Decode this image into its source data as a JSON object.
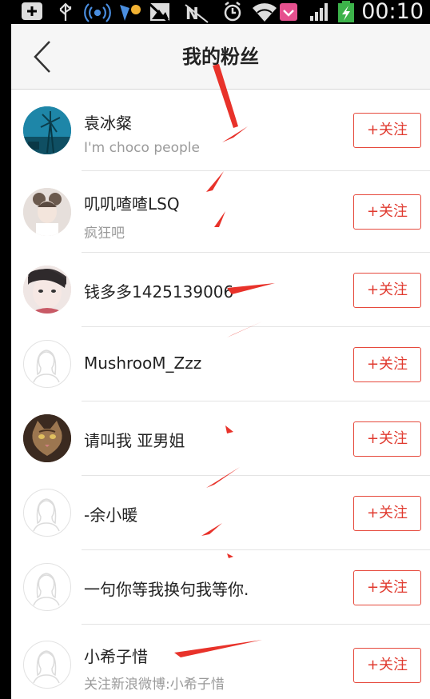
{
  "status_bar": {
    "time": "00:10",
    "icons": [
      "add-icon",
      "usb-icon",
      "wifi-hotspot-icon",
      "notification-app-icon",
      "picture-icon",
      "nfc-icon",
      "alarm-icon",
      "wifi-icon",
      "message-icon",
      "signal-icon",
      "battery-charging-icon"
    ]
  },
  "navbar": {
    "back_icon": "chevron-left-icon",
    "title": "我的粉丝"
  },
  "fans": [
    {
      "name": "袁冰粲",
      "subtitle": "I'm choco people",
      "avatar": "windmill-photo",
      "follow_label": "+关注"
    },
    {
      "name": "叽叽喳喳LSQ",
      "subtitle": "疯狂吧",
      "avatar": "girl-photo",
      "follow_label": "+关注"
    },
    {
      "name": "钱多多1425139006",
      "subtitle": "",
      "avatar": "face-photo",
      "follow_label": "+关注"
    },
    {
      "name": "MushrooM_Zzz",
      "subtitle": "",
      "avatar": "default-avatar",
      "follow_label": "+关注"
    },
    {
      "name": "请叫我 亚男姐",
      "subtitle": "",
      "avatar": "cat-photo",
      "follow_label": "+关注"
    },
    {
      "name": "-余小暖",
      "subtitle": "",
      "avatar": "default-avatar",
      "follow_label": "+关注"
    },
    {
      "name": "一句你等我换句我等你.",
      "subtitle": "",
      "avatar": "default-avatar",
      "follow_label": "+关注"
    },
    {
      "name": "小希子惜",
      "subtitle": "关注新浪微博:小希子惜",
      "avatar": "default-avatar",
      "follow_label": "+关注"
    }
  ],
  "colors": {
    "accent": "#e03a2f",
    "annotation_arrow": "#e8322a",
    "navbar_bg": "#f6f6f6",
    "subtitle": "#9a9a9a"
  }
}
